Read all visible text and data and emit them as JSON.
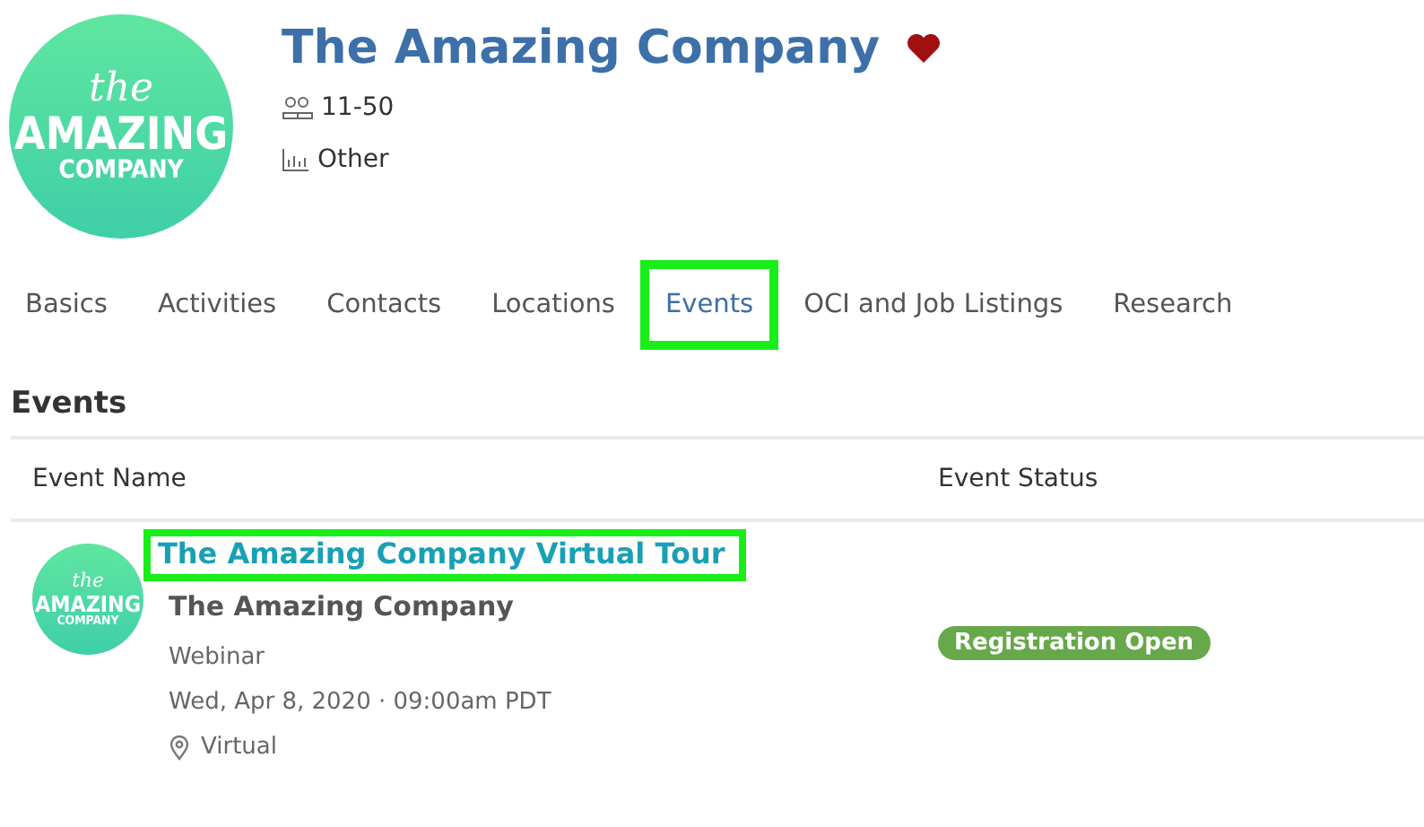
{
  "company": {
    "logo": {
      "line_1": "the",
      "line_2": "AMAZING",
      "line_3": "COMPANY"
    },
    "name": "The Amazing Company",
    "favorite": true,
    "size": "11-50",
    "industry": "Other"
  },
  "tabs": [
    {
      "label": "Basics",
      "selected": false,
      "highlighted": false
    },
    {
      "label": "Activities",
      "selected": false,
      "highlighted": false
    },
    {
      "label": "Contacts",
      "selected": false,
      "highlighted": false
    },
    {
      "label": "Locations",
      "selected": false,
      "highlighted": false
    },
    {
      "label": "Events",
      "selected": true,
      "highlighted": true
    },
    {
      "label": "OCI and Job Listings",
      "selected": false,
      "highlighted": false
    },
    {
      "label": "Research",
      "selected": false,
      "highlighted": false
    }
  ],
  "events_section": {
    "title": "Events",
    "columns": [
      "Event Name",
      "Event Status"
    ],
    "rows": [
      {
        "logo": {
          "line_1": "the",
          "line_2": "AMAZING",
          "line_3": "COMPANY"
        },
        "title": "The Amazing Company Virtual Tour",
        "title_highlighted": true,
        "organizer": "The Amazing Company",
        "type": "Webinar",
        "date_time": "Wed, Apr 8, 2020 · 09:00am PDT",
        "location": "Virtual",
        "status": "Registration Open",
        "color": "#67a84a"
      }
    ]
  }
}
